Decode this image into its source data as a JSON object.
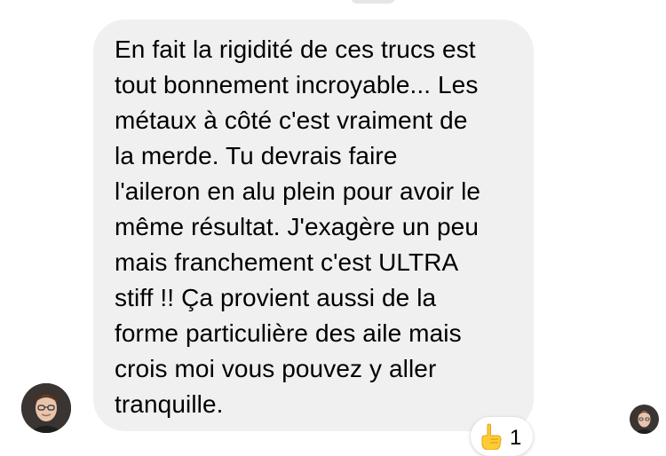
{
  "conversation": {
    "message": {
      "text": "En fait la rigidité de ces trucs est\ntout bonnement incroyable... Les\nmétaux à côté c'est vraiment de\nla merde. Tu devrais faire\nl'aileron en alu plein pour avoir le\nmême résultat. J'exagère un peu\nmais franchement c'est ULTRA\nstiff !! Ça provient aussi de la\nforme particulière des aile mais\ncrois moi vous pouvez y aller\ntranquille."
    },
    "reaction": {
      "emoji": "pointing-hand-emoji",
      "count": "1"
    },
    "colors": {
      "bubble_background": "#f1f0f0",
      "text": "#000000",
      "background": "#ffffff"
    }
  }
}
